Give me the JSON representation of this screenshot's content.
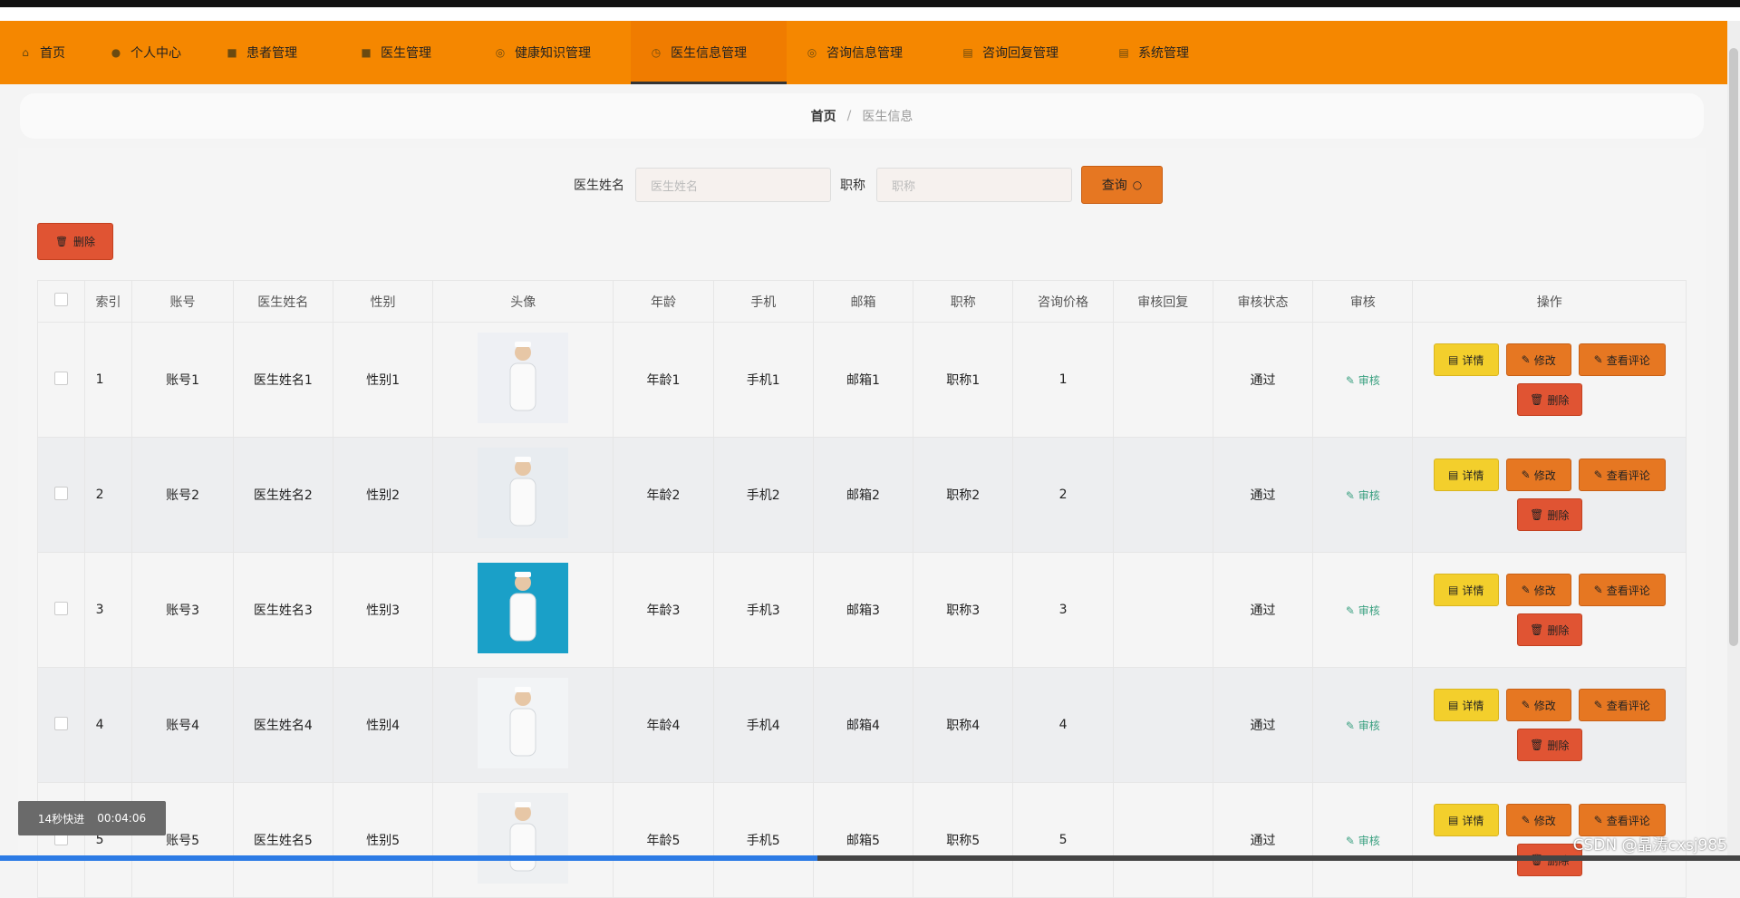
{
  "nav": [
    {
      "label": "首页",
      "icon": "home-icon",
      "glyph": "⌂"
    },
    {
      "label": "个人中心",
      "icon": "user-icon",
      "glyph": "●"
    },
    {
      "label": "患者管理",
      "icon": "chat-icon",
      "glyph": "■"
    },
    {
      "label": "医生管理",
      "icon": "chat-icon",
      "glyph": "■"
    },
    {
      "label": "健康知识管理",
      "icon": "compass-icon",
      "glyph": "◎"
    },
    {
      "label": "医生信息管理",
      "icon": "clock-icon",
      "glyph": "◷"
    },
    {
      "label": "咨询信息管理",
      "icon": "compass-icon",
      "glyph": "◎"
    },
    {
      "label": "咨询回复管理",
      "icon": "clipboard-icon",
      "glyph": "▤"
    },
    {
      "label": "系统管理",
      "icon": "clipboard-icon",
      "glyph": "▤"
    }
  ],
  "breadcrumb": {
    "home": "首页",
    "sep": "/",
    "current": "医生信息"
  },
  "search": {
    "name_label": "医生姓名",
    "name_placeholder": "医生姓名",
    "title_label": "职称",
    "title_placeholder": "职称",
    "query_label": "查询"
  },
  "delete_label": "删除",
  "table": {
    "headers": [
      "",
      "索引",
      "账号",
      "医生姓名",
      "性别",
      "头像",
      "年龄",
      "手机",
      "邮箱",
      "职称",
      "咨询价格",
      "审核回复",
      "审核状态",
      "审核",
      "操作"
    ],
    "rows": [
      {
        "index": "1",
        "account": "账号1",
        "name": "医生姓名1",
        "gender": "性别1",
        "age": "年龄1",
        "phone": "手机1",
        "email": "邮箱1",
        "title": "职称1",
        "price": "1",
        "reply": "",
        "status": "通过",
        "audit": "审核"
      },
      {
        "index": "2",
        "account": "账号2",
        "name": "医生姓名2",
        "gender": "性别2",
        "age": "年龄2",
        "phone": "手机2",
        "email": "邮箱2",
        "title": "职称2",
        "price": "2",
        "reply": "",
        "status": "通过",
        "audit": "审核"
      },
      {
        "index": "3",
        "account": "账号3",
        "name": "医生姓名3",
        "gender": "性别3",
        "age": "年龄3",
        "phone": "手机3",
        "email": "邮箱3",
        "title": "职称3",
        "price": "3",
        "reply": "",
        "status": "通过",
        "audit": "审核"
      },
      {
        "index": "4",
        "account": "账号4",
        "name": "医生姓名4",
        "gender": "性别4",
        "age": "年龄4",
        "phone": "手机4",
        "email": "邮箱4",
        "title": "职称4",
        "price": "4",
        "reply": "",
        "status": "通过",
        "audit": "审核"
      },
      {
        "index": "5",
        "account": "账号5",
        "name": "医生姓名5",
        "gender": "性别5",
        "age": "年龄5",
        "phone": "手机5",
        "email": "邮箱5",
        "title": "职称5",
        "price": "5",
        "reply": "",
        "status": "通过",
        "audit": "审核"
      }
    ],
    "ops": {
      "detail": "详情",
      "edit": "修改",
      "comment": "查看评论",
      "delete": "删除"
    }
  },
  "toast": {
    "text": "14秒快进",
    "time": "00:04:06"
  },
  "watermark": "CSDN @晶涛cxsj985",
  "playback_progress": 0.47,
  "colors": {
    "nav_bg": "#f58700",
    "primary": "#e67722",
    "danger": "#e05433",
    "warning": "#f3cf2c",
    "audit": "#3aa080"
  }
}
